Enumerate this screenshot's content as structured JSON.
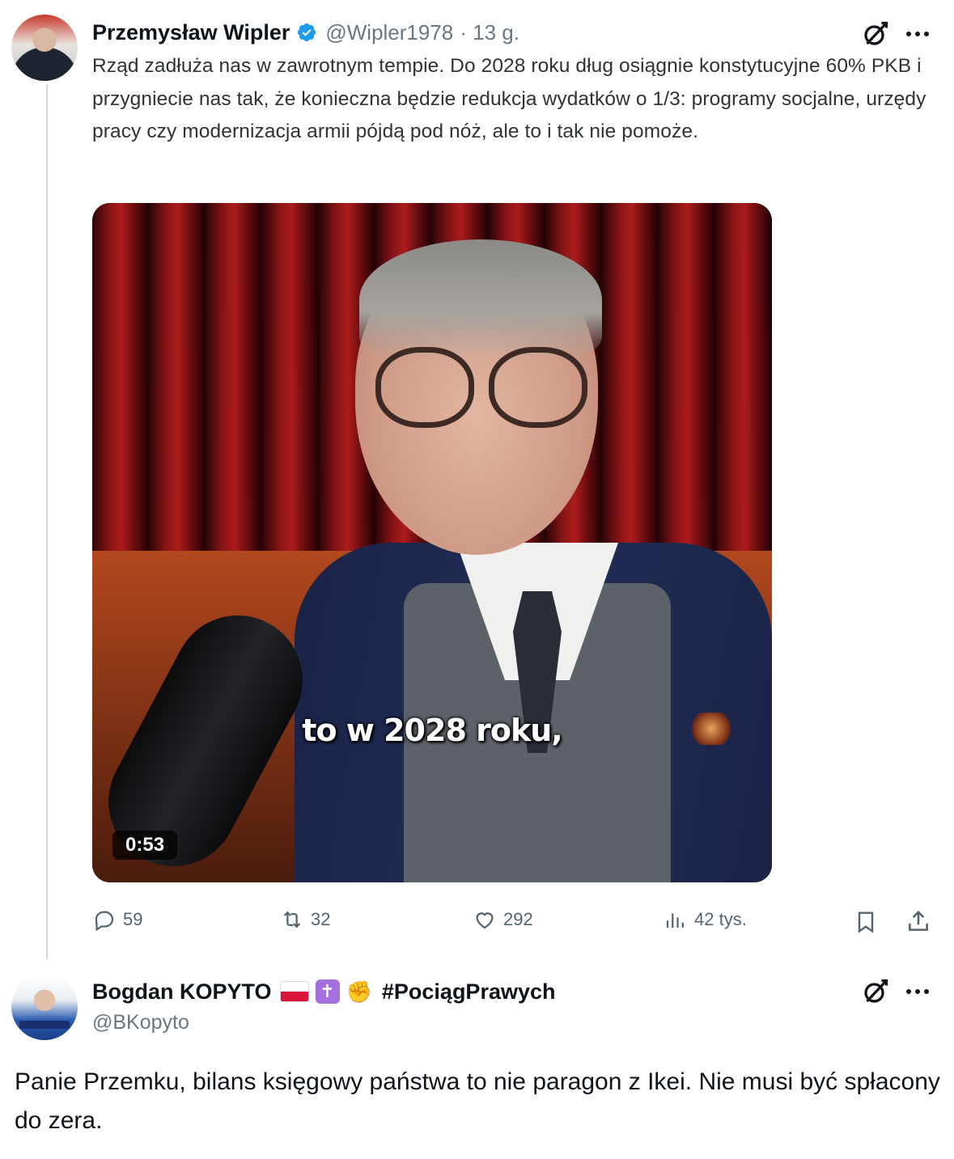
{
  "tweet": {
    "author_name": "Przemysław Wipler",
    "author_handle": "@Wipler1978",
    "time": "· 13 g.",
    "text": "Rząd zadłuża nas w zawrotnym tempie. Do 2028 roku dług osiągnie konstytucyjne 60% PKB i przygniecie nas tak, że konieczna będzie redukcja wydatków o 1/3: programy socjalne, urzędy pracy czy modernizacja armii pójdą pod nóż, ale to i tak nie pomoże.",
    "video": {
      "caption": "to w 2028 roku,",
      "duration": "0:53"
    },
    "stats": {
      "replies": "59",
      "reposts": "32",
      "likes": "292",
      "views": "42 tys."
    }
  },
  "reply": {
    "author_name": "Bogdan KOPYTO",
    "emoji_cross": "✝",
    "emoji_fist": "✊",
    "hashtag": "#PociągPrawych",
    "author_handle": "@BKopyto",
    "text": "Panie Przemku, bilans księgowy państwa to nie paragon z Ikei. Nie musi być spłacony do zera."
  },
  "icons": [
    "grok-icon",
    "more-icon",
    "verified-badge-icon",
    "reply-icon",
    "repost-icon",
    "like-icon",
    "views-icon",
    "bookmark-icon",
    "share-icon"
  ],
  "colors": {
    "verified": "#1d9bf0",
    "muted": "#536471",
    "text": "#0f1419"
  }
}
